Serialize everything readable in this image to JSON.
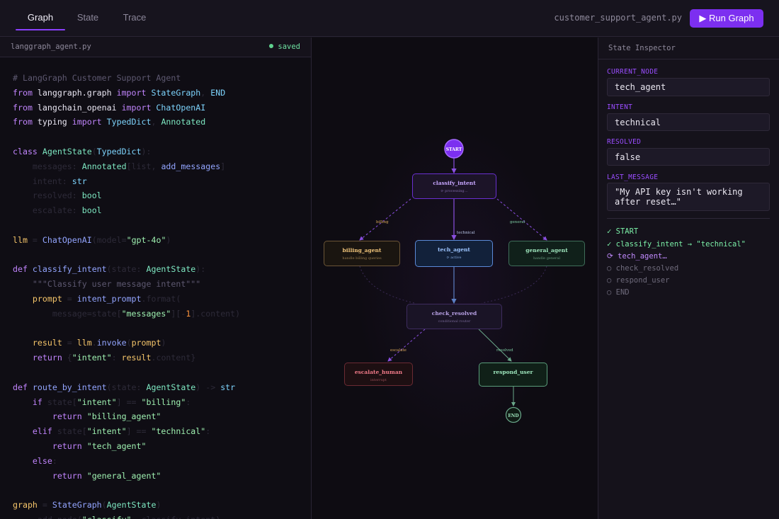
{
  "tabs": [
    "Graph",
    "State",
    "Trace"
  ],
  "header": {
    "filename": "customer_support_agent.py",
    "run_button": "▶ Run Graph"
  },
  "editor": {
    "filename": "langgraph_agent.py",
    "status": "saved",
    "lines": [
      [
        [
          "c-com",
          "# LangGraph Customer Support Agent"
        ]
      ],
      [
        [
          "c-kw",
          "from"
        ],
        [
          "c-mod",
          " langgraph.graph "
        ],
        [
          "c-kw",
          "import"
        ],
        [
          "c-cls",
          " StateGraph"
        ],
        [
          "c-dim",
          ", "
        ],
        [
          "c-cls",
          "END"
        ]
      ],
      [
        [
          "c-kw",
          "from"
        ],
        [
          "c-mod",
          " langchain_openai "
        ],
        [
          "c-kw",
          "import"
        ],
        [
          "c-cls",
          " ChatOpenAI"
        ]
      ],
      [
        [
          "c-kw",
          "from"
        ],
        [
          "c-mod",
          " typing "
        ],
        [
          "c-kw",
          "import"
        ],
        [
          "c-cls",
          " TypedDict"
        ],
        [
          "c-dim",
          ", "
        ],
        [
          "c-typ",
          "Annotated"
        ]
      ],
      [],
      [
        [
          "c-kw",
          "class"
        ],
        [
          "c-typ",
          " AgentState"
        ],
        [
          "c-dim",
          "("
        ],
        [
          "c-cls",
          "TypedDict"
        ],
        [
          "c-dim",
          "):"
        ]
      ],
      [
        [
          "c-dim",
          "    messages: "
        ],
        [
          "c-typ",
          "Annotated"
        ],
        [
          "c-dim",
          "[list, "
        ],
        [
          "c-fn",
          "add_messages"
        ],
        [
          "c-dim",
          "]"
        ]
      ],
      [
        [
          "c-dim",
          "    intent: "
        ],
        [
          "c-cls",
          "str"
        ]
      ],
      [
        [
          "c-dim",
          "    resolved: "
        ],
        [
          "c-typ",
          "bool"
        ]
      ],
      [
        [
          "c-dim",
          "    escalate: "
        ],
        [
          "c-typ",
          "bool"
        ]
      ],
      [],
      [
        [
          "c-var",
          "llm"
        ],
        [
          "c-dim",
          " = "
        ],
        [
          "c-fn",
          "ChatOpenAI"
        ],
        [
          "c-dim",
          "(model="
        ],
        [
          "c-str",
          "\"gpt-4o\""
        ],
        [
          "c-dim",
          ")"
        ]
      ],
      [],
      [
        [
          "c-kw",
          "def"
        ],
        [
          "c-fn",
          " classify_intent"
        ],
        [
          "c-dim",
          "(state: "
        ],
        [
          "c-typ",
          "AgentState"
        ],
        [
          "c-dim",
          "):"
        ]
      ],
      [
        [
          "c-com",
          "    \"\"\"Classify user message intent\"\"\""
        ]
      ],
      [
        [
          "c-var",
          "    prompt"
        ],
        [
          "c-dim",
          " = "
        ],
        [
          "c-fn",
          "intent_prompt"
        ],
        [
          "c-dim",
          ".format("
        ]
      ],
      [
        [
          "c-dim",
          "        message=state["
        ],
        [
          "c-str",
          "\"messages\""
        ],
        [
          "c-dim",
          "][-"
        ],
        [
          "c-num",
          "1"
        ],
        [
          "c-dim",
          "].content)"
        ]
      ],
      [],
      [
        [
          "c-var",
          "    result"
        ],
        [
          "c-dim",
          " = "
        ],
        [
          "c-var",
          "llm"
        ],
        [
          "c-dim",
          "."
        ],
        [
          "c-fn",
          "invoke"
        ],
        [
          "c-dim",
          "("
        ],
        [
          "c-var",
          "prompt"
        ],
        [
          "c-dim",
          ")"
        ]
      ],
      [
        [
          "c-kw",
          "    return"
        ],
        [
          "c-dim",
          " {"
        ],
        [
          "c-str",
          "\"intent\""
        ],
        [
          "c-dim",
          ": "
        ],
        [
          "c-var",
          "result"
        ],
        [
          "c-dim",
          ".content}"
        ]
      ],
      [],
      [
        [
          "c-kw",
          "def"
        ],
        [
          "c-fn",
          " route_by_intent"
        ],
        [
          "c-dim",
          "(state: "
        ],
        [
          "c-typ",
          "AgentState"
        ],
        [
          "c-dim",
          ") -> "
        ],
        [
          "c-cls",
          "str"
        ]
      ],
      [
        [
          "c-kw",
          "    if"
        ],
        [
          "c-dim",
          " state["
        ],
        [
          "c-str",
          "\"intent\""
        ],
        [
          "c-dim",
          "] == "
        ],
        [
          "c-str",
          "\"billing\""
        ],
        [
          "c-dim",
          ":"
        ]
      ],
      [
        [
          "c-kw",
          "        return"
        ],
        [
          "c-str",
          " \"billing_agent\""
        ]
      ],
      [
        [
          "c-kw",
          "    elif"
        ],
        [
          "c-dim",
          " state["
        ],
        [
          "c-str",
          "\"intent\""
        ],
        [
          "c-dim",
          "] == "
        ],
        [
          "c-str",
          "\"technical\""
        ],
        [
          "c-dim",
          ":"
        ]
      ],
      [
        [
          "c-kw",
          "        return"
        ],
        [
          "c-str",
          " \"tech_agent\""
        ]
      ],
      [
        [
          "c-kw",
          "    else"
        ],
        [
          "c-dim",
          ":"
        ]
      ],
      [
        [
          "c-kw",
          "        return"
        ],
        [
          "c-str",
          " \"general_agent\""
        ]
      ],
      [],
      [
        [
          "c-var",
          "graph"
        ],
        [
          "c-dim",
          " = "
        ],
        [
          "c-fn",
          "StateGraph"
        ],
        [
          "c-dim",
          "("
        ],
        [
          "c-typ",
          "AgentState"
        ],
        [
          "c-dim",
          ")"
        ]
      ],
      [
        [
          "c-dim",
          "    .add_node("
        ],
        [
          "c-str",
          "\"classify\""
        ],
        [
          "c-dim",
          ", classify_intent)"
        ]
      ]
    ]
  },
  "graph": {
    "start": "START",
    "end": "END",
    "nodes": {
      "classify_intent": {
        "title": "classify_intent",
        "sub": "⟳ processing…"
      },
      "billing_agent": {
        "title": "billing_agent",
        "sub": "handle billing queries"
      },
      "tech_agent": {
        "title": "tech_agent",
        "sub": "⟳ active"
      },
      "general_agent": {
        "title": "general_agent",
        "sub": "handle general"
      },
      "check_resolved": {
        "title": "check_resolved",
        "sub": "conditional router"
      },
      "escalate_human": {
        "title": "escalate_human",
        "sub": "interrupt"
      },
      "respond_user": {
        "title": "respond_user",
        "sub": ""
      }
    },
    "edge_labels": {
      "billing": "billing",
      "technical": "technical",
      "general": "general",
      "escalate": "escalate",
      "resolved": "resolved"
    }
  },
  "inspector": {
    "title": "State Inspector",
    "fields": [
      {
        "label": "CURRENT_NODE",
        "value": "tech_agent"
      },
      {
        "label": "INTENT",
        "value": "technical"
      },
      {
        "label": "RESOLVED",
        "value": "false"
      },
      {
        "label": "LAST_MESSAGE",
        "value": "\"My API key isn't working after reset…\""
      }
    ],
    "trace": [
      {
        "text": "✓ START",
        "status": "done"
      },
      {
        "text": "✓ classify_intent → \"technical\"",
        "status": "done"
      },
      {
        "text": "⟳ tech_agent…",
        "status": "running"
      },
      {
        "text": "○ check_resolved",
        "status": "pending"
      },
      {
        "text": "○ respond_user",
        "status": "pending"
      },
      {
        "text": "○ END",
        "status": "pending"
      }
    ]
  },
  "colors": {
    "accent": "#8a3ffc",
    "done": "#7cf0a8",
    "running": "#c28bff",
    "pending": "#6e6a7b"
  }
}
